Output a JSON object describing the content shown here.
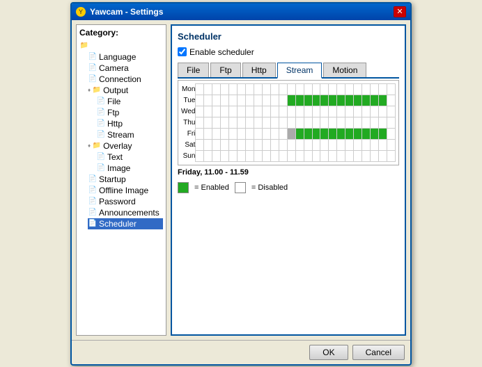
{
  "window": {
    "title": "Yawcam - Settings",
    "close_label": "✕"
  },
  "category": {
    "label": "Category:",
    "items": [
      {
        "id": "root-folder",
        "label": "",
        "indent": 0,
        "type": "folder"
      },
      {
        "id": "language",
        "label": "Language",
        "indent": 1,
        "type": "doc"
      },
      {
        "id": "camera",
        "label": "Camera",
        "indent": 1,
        "type": "doc"
      },
      {
        "id": "connection",
        "label": "Connection",
        "indent": 1,
        "type": "doc"
      },
      {
        "id": "output",
        "label": "Output",
        "indent": 1,
        "type": "folder"
      },
      {
        "id": "file",
        "label": "File",
        "indent": 2,
        "type": "doc"
      },
      {
        "id": "ftp",
        "label": "Ftp",
        "indent": 2,
        "type": "doc"
      },
      {
        "id": "http",
        "label": "Http",
        "indent": 2,
        "type": "doc"
      },
      {
        "id": "stream",
        "label": "Stream",
        "indent": 2,
        "type": "doc"
      },
      {
        "id": "overlay",
        "label": "Overlay",
        "indent": 1,
        "type": "folder"
      },
      {
        "id": "text",
        "label": "Text",
        "indent": 2,
        "type": "doc"
      },
      {
        "id": "image",
        "label": "Image",
        "indent": 2,
        "type": "doc"
      },
      {
        "id": "startup",
        "label": "Startup",
        "indent": 1,
        "type": "doc"
      },
      {
        "id": "offline-image",
        "label": "Offline Image",
        "indent": 1,
        "type": "doc"
      },
      {
        "id": "password",
        "label": "Password",
        "indent": 1,
        "type": "doc"
      },
      {
        "id": "announcements",
        "label": "Announcements",
        "indent": 1,
        "type": "doc"
      },
      {
        "id": "scheduler",
        "label": "Scheduler",
        "indent": 1,
        "type": "doc",
        "selected": true
      }
    ]
  },
  "scheduler": {
    "title": "Scheduler",
    "enable_label": "Enable scheduler",
    "enabled": true,
    "tabs": [
      "File",
      "Ftp",
      "Http",
      "Stream",
      "Motion"
    ],
    "active_tab": "Stream",
    "status_text": "Friday, 11.00 - 11.59",
    "legend": {
      "enabled_label": "= Enabled",
      "disabled_label": "= Disabled"
    },
    "days": [
      "Mon",
      "Tue",
      "Wed",
      "Thu",
      "Fri",
      "Sat",
      "Sun"
    ],
    "grid": {
      "Mon": [
        0,
        0,
        0,
        0,
        0,
        0,
        0,
        0,
        0,
        0,
        0,
        0,
        0,
        0,
        0,
        0,
        0,
        0,
        0,
        0,
        0,
        0,
        0,
        0
      ],
      "Tue": [
        0,
        0,
        0,
        0,
        0,
        0,
        0,
        0,
        0,
        0,
        0,
        1,
        1,
        1,
        1,
        1,
        1,
        1,
        1,
        1,
        1,
        1,
        1,
        0
      ],
      "Wed": [
        0,
        0,
        0,
        0,
        0,
        0,
        0,
        0,
        0,
        0,
        0,
        0,
        0,
        0,
        0,
        0,
        0,
        0,
        0,
        0,
        0,
        0,
        0,
        0
      ],
      "Thu": [
        0,
        0,
        0,
        0,
        0,
        0,
        0,
        0,
        0,
        0,
        0,
        0,
        0,
        0,
        0,
        0,
        0,
        0,
        0,
        0,
        0,
        0,
        0,
        0
      ],
      "Fri": [
        0,
        0,
        0,
        0,
        0,
        0,
        0,
        0,
        0,
        0,
        0,
        2,
        1,
        1,
        1,
        1,
        1,
        1,
        1,
        1,
        1,
        1,
        1,
        0
      ],
      "Sat": [
        0,
        0,
        0,
        0,
        0,
        0,
        0,
        0,
        0,
        0,
        0,
        0,
        0,
        0,
        0,
        0,
        0,
        0,
        0,
        0,
        0,
        0,
        0,
        0
      ],
      "Sun": [
        0,
        0,
        0,
        0,
        0,
        0,
        0,
        0,
        0,
        0,
        0,
        0,
        0,
        0,
        0,
        0,
        0,
        0,
        0,
        0,
        0,
        0,
        0,
        0
      ]
    }
  },
  "buttons": {
    "ok_label": "OK",
    "cancel_label": "Cancel"
  }
}
